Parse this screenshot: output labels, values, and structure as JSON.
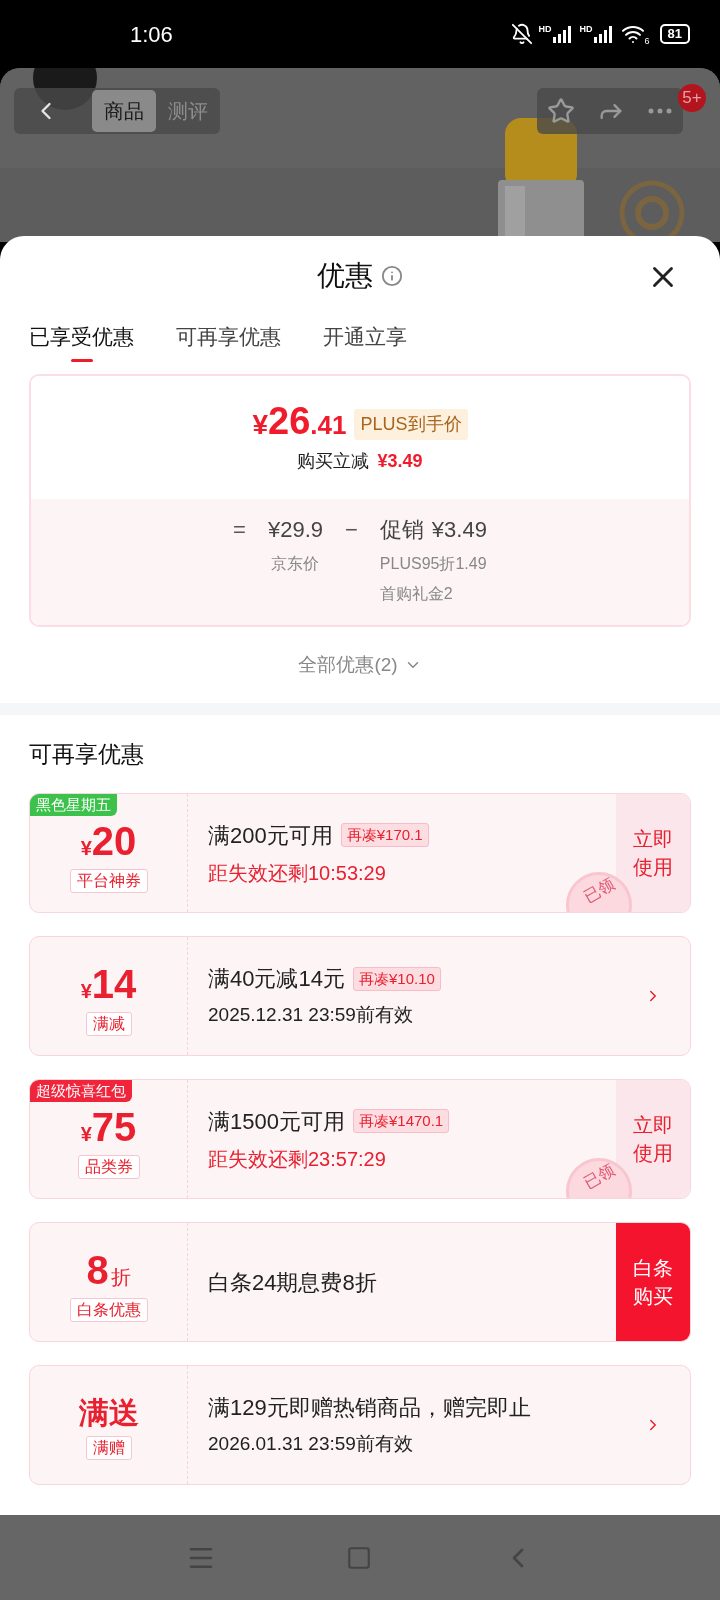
{
  "status_bar": {
    "time": "1:06",
    "signals": [
      "HD",
      "HD"
    ],
    "wifi_label": "6",
    "battery": "81"
  },
  "background_page": {
    "tabs": [
      {
        "label": "商品",
        "selected": true
      },
      {
        "label": "测评",
        "selected": false
      }
    ],
    "badge": "5+"
  },
  "sheet": {
    "title": "优惠",
    "tabs": [
      {
        "label": "已享受优惠",
        "selected": true
      },
      {
        "label": "可再享优惠",
        "selected": false
      },
      {
        "label": "开通立享",
        "selected": false
      }
    ],
    "price_card": {
      "currency": "¥",
      "price_int": "26",
      "price_dec": ".41",
      "price_tag": "PLUS到手价",
      "saving_label": "购买立减",
      "saving": "¥3.49",
      "equals": "=",
      "base_price": "¥29.9",
      "base_label": "京东价",
      "minus": "−",
      "promo_label": "促销",
      "promo": "¥3.49",
      "promo_details": [
        "PLUS95折1.49",
        "首购礼金2"
      ]
    },
    "all_offers": "全部优惠(2)",
    "section_title": "可再享优惠",
    "coupons": [
      {
        "kind": "use",
        "tag": "黑色星期五",
        "color": "#3cc24b",
        "currency": "¥",
        "amount": {
          "kind": "number",
          "text": "20"
        },
        "type_label": "平台神券",
        "title": "满200元可用",
        "gap": "再凑¥170.1",
        "subtitle": {
          "kind": "countdown",
          "text": "距失效还剩10:53:29"
        },
        "action": "立即使用",
        "stamp": "已领"
      },
      {
        "kind": "arrow",
        "currency": "¥",
        "amount": {
          "kind": "number",
          "text": "14"
        },
        "type_label": "满减",
        "title": "满40元减14元",
        "gap": "再凑¥10.10",
        "subtitle": {
          "kind": "date",
          "text": "2025.12.31 23:59前有效"
        }
      },
      {
        "kind": "use",
        "tag": "超级惊喜红包",
        "color": "#f0243a",
        "currency": "¥",
        "amount": {
          "kind": "number",
          "text": "75"
        },
        "type_label": "品类券",
        "title": "满1500元可用",
        "gap": "再凑¥1470.1",
        "subtitle": {
          "kind": "countdown",
          "text": "距失效还剩23:57:29"
        },
        "action": "立即使用",
        "stamp": "已领"
      },
      {
        "kind": "primary",
        "amount": {
          "kind": "number",
          "text": "8"
        },
        "unit": "折",
        "type_label": "白条优惠",
        "title": "白条24期息费8折",
        "action": "白条购买"
      },
      {
        "kind": "arrow",
        "amount": {
          "kind": "text",
          "text": "满送"
        },
        "type_label": "满赠",
        "title": "满129元即赠热销商品，赠完即止",
        "subtitle": {
          "kind": "date",
          "text": "2026.01.31 23:59前有效"
        }
      }
    ]
  }
}
